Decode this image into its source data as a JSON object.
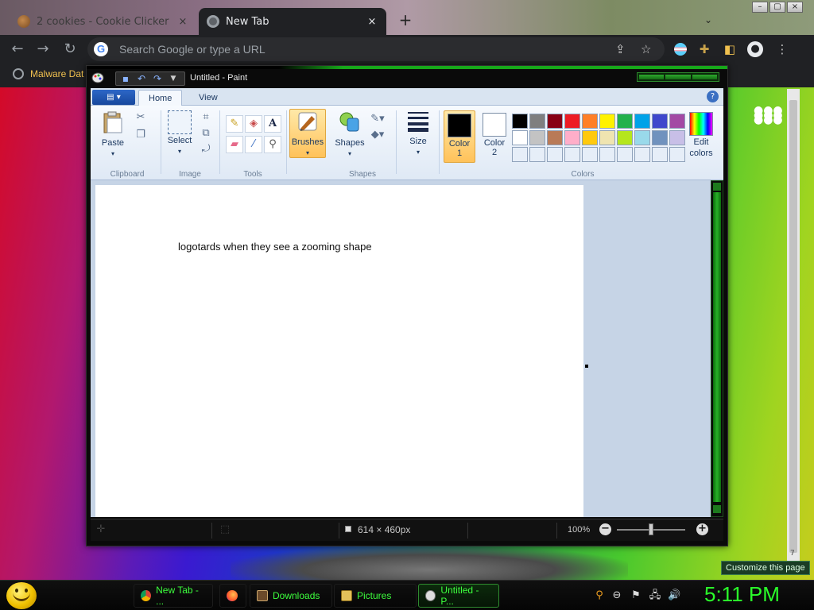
{
  "browser": {
    "tabs": [
      {
        "label": "2 cookies - Cookie Clicker",
        "close": "×"
      },
      {
        "label": "New Tab",
        "close": "×"
      }
    ],
    "new_tab_symbol": "+",
    "omnibox_placeholder": "Search Google or type a URL",
    "google_letter": "G",
    "bookmark_label": "Malware Dat",
    "customize_label": "Customize this page",
    "scroll_badge": "7"
  },
  "paint": {
    "title": "Untitled - Paint",
    "tabs": {
      "home": "Home",
      "view": "View"
    },
    "help": "?",
    "groups": {
      "clipboard": "Clipboard",
      "image": "Image",
      "tools": "Tools",
      "shapes": "Shapes",
      "colors": "Colors"
    },
    "buttons": {
      "paste": "Paste",
      "select": "Select",
      "brushes": "Brushes",
      "shapes": "Shapes",
      "size": "Size",
      "color1_a": "Color",
      "color1_b": "1",
      "color2_a": "Color",
      "color2_b": "2",
      "edit_colors_a": "Edit",
      "edit_colors_b": "colors",
      "text_tool": "A"
    },
    "canvas_text": "logotards when they see a zooming shape",
    "status": {
      "dimensions": "614 × 460px",
      "zoom": "100%"
    },
    "colors": {
      "color1": "#000000",
      "color2": "#ffffff",
      "palette_row1": [
        "#000000",
        "#7f7f7f",
        "#880015",
        "#ed1c24",
        "#ff7f27",
        "#fff200",
        "#22b14c",
        "#00a2e8",
        "#3f48cc",
        "#a349a4"
      ],
      "palette_row2": [
        "#ffffff",
        "#c3c3c3",
        "#b97a57",
        "#ffaec9",
        "#ffc90e",
        "#efe4b0",
        "#b5e61d",
        "#99d9ea",
        "#7092be",
        "#c8bfe7"
      ]
    }
  },
  "taskbar": {
    "items": [
      {
        "label": "New Tab - ..."
      },
      {
        "label": ""
      },
      {
        "label": "Downloads"
      },
      {
        "label": "Pictures"
      },
      {
        "label": "Untitled - P..."
      }
    ],
    "clock": "5:11 PM"
  }
}
